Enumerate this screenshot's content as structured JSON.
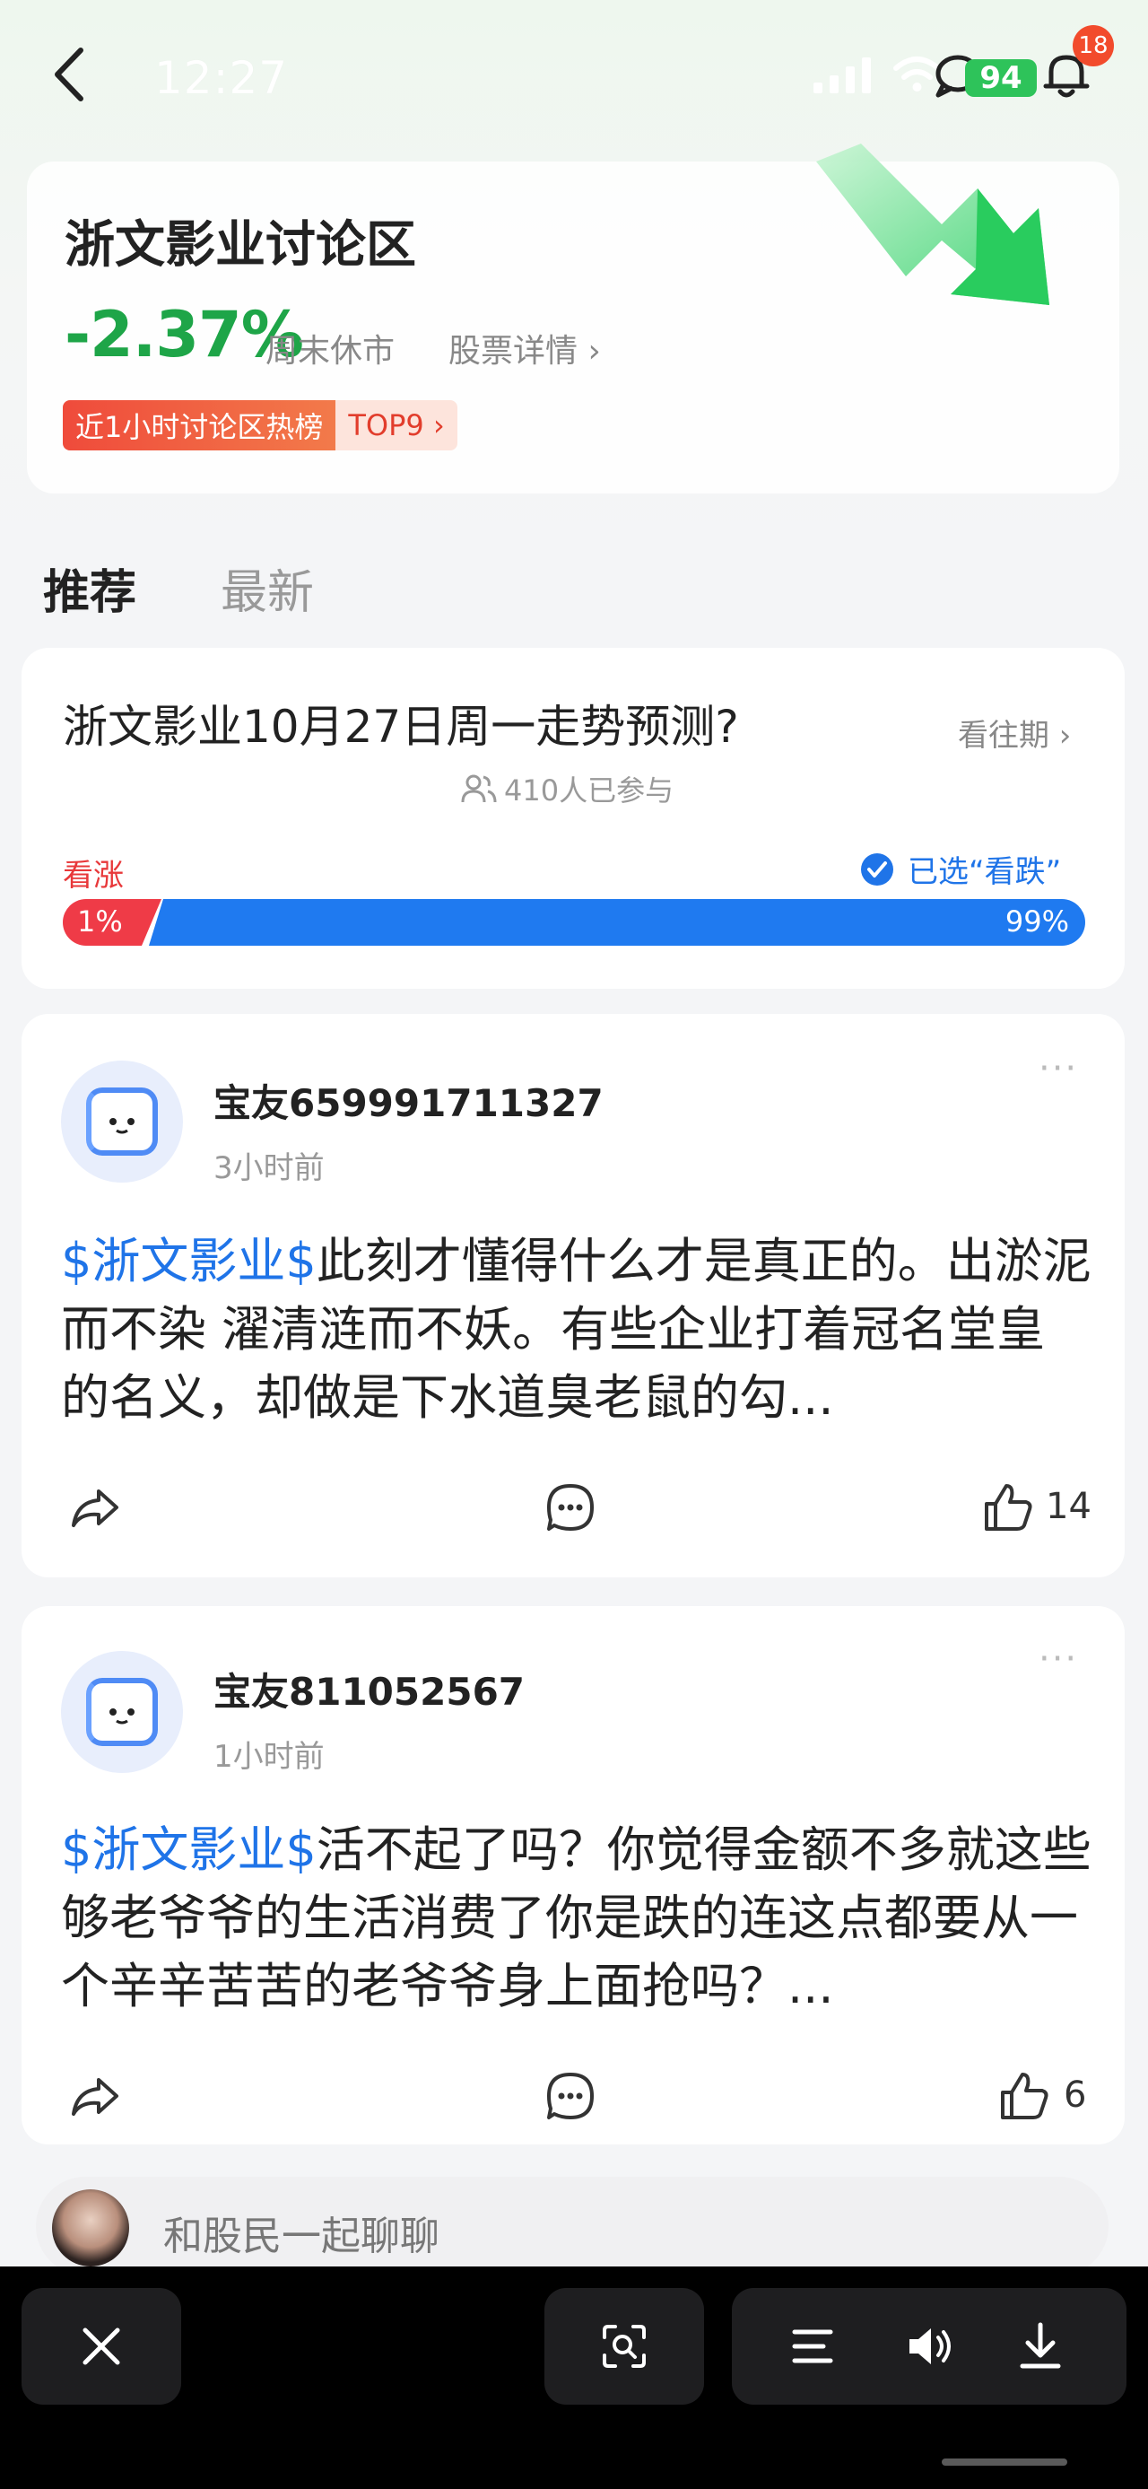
{
  "status_bar": {
    "time": "12:27",
    "battery": "94",
    "notification_count": "18"
  },
  "header": {
    "stock_name": "浙文影业讨论区",
    "change": "-2.37%",
    "market_status": "周末休市",
    "detail_link": "股票详情 ›",
    "hot_rank_label": "近1小时讨论区热榜",
    "hot_rank_value": "TOP9 ›"
  },
  "tabs": [
    {
      "label": "推荐",
      "active": true
    },
    {
      "label": "最新",
      "active": false
    }
  ],
  "poll": {
    "title": "浙文影业10月27日周一走势预测?",
    "history_link": "看往期 ›",
    "participants": "410人已参与",
    "rise_label": "看涨",
    "selected_label": "已选“看跌”",
    "rise_percent_text": "1%",
    "fall_percent_text": "99%",
    "rise_fraction": 0.01,
    "fall_fraction": 0.99
  },
  "posts": [
    {
      "author": "宝友659991711327",
      "time": "3小时前",
      "tag": "$浙文影业$",
      "text": "此刻才懂得什么才是真正的。出淤泥而不染 濯清涟而不妖。有些企业打着冠名堂皇的名义，却做是下水道臭老鼠的勾...",
      "likes": "14"
    },
    {
      "author": "宝友811052567",
      "time": "1小时前",
      "tag": "$浙文影业$",
      "text": "活不起了吗？你觉得金额不多就这些够老爷爷的生活消费了你是跌的连这点都要从一个辛辛苦苦的老爷爷身上面抢吗？...",
      "likes": "6"
    }
  ],
  "comment_box": {
    "placeholder": "和股民一起聊聊"
  },
  "colors": {
    "down_green": "#1ea548",
    "rise_red": "#ef3b47",
    "fall_blue": "#1f7af0",
    "link_blue": "#1f74e8"
  },
  "icons": [
    "back-icon",
    "signal-icon",
    "wifi-icon",
    "chat-icon",
    "bell-icon",
    "share-icon",
    "comment-icon",
    "like-icon",
    "close-icon",
    "scan-icon",
    "menu-icon",
    "volume-icon",
    "download-icon"
  ]
}
